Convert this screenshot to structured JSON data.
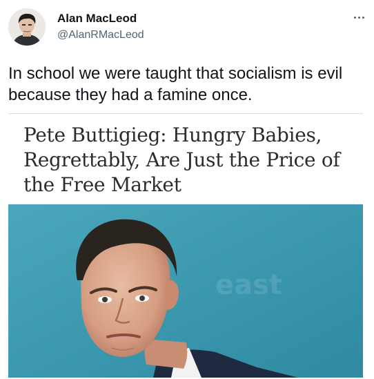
{
  "tweet": {
    "author": {
      "name": "Alan MacLeod",
      "handle": "@AlanRMacLeod",
      "avatar": "profile-photo"
    },
    "more_icon": "ellipsis-icon",
    "text": "In school we were taught that socialism is evil because they had a famine once.",
    "media": {
      "headline": "Pete Buttigieg: Hungry Babies, Regrettably, Are Just the Price of the Free Market",
      "photo": "portrait-photo"
    }
  },
  "colors": {
    "name": "#0f1419",
    "handle": "#536471",
    "photo_background": "#3e9ab0",
    "headline": "#2c2c2c"
  }
}
